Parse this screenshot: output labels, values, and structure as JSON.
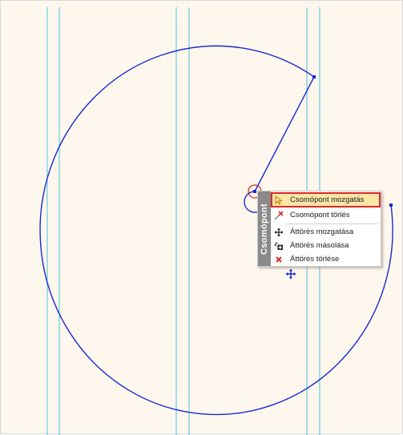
{
  "context_menu": {
    "sidebar_label": "Csomópont",
    "items": [
      {
        "label": "Csomópont mozgatás",
        "icon": "node-move-icon",
        "highlighted": true
      },
      {
        "label": "Csomópont törlés",
        "icon": "node-delete-icon"
      },
      {
        "label": "Áttörés mozgatása",
        "icon": "move-arrows-icon"
      },
      {
        "label": "Áttörés másolása",
        "icon": "copy-move-icon"
      },
      {
        "label": "Áttörés törlése",
        "icon": "delete-x-icon"
      }
    ]
  },
  "colors": {
    "background": "#fdf7ee",
    "curve": "#1a2ad6",
    "guides": "#4cc3d9",
    "highlight_fill": "#fbe6a6",
    "highlight_border": "#d92b2b",
    "sidebar": "#8a8a8a"
  }
}
